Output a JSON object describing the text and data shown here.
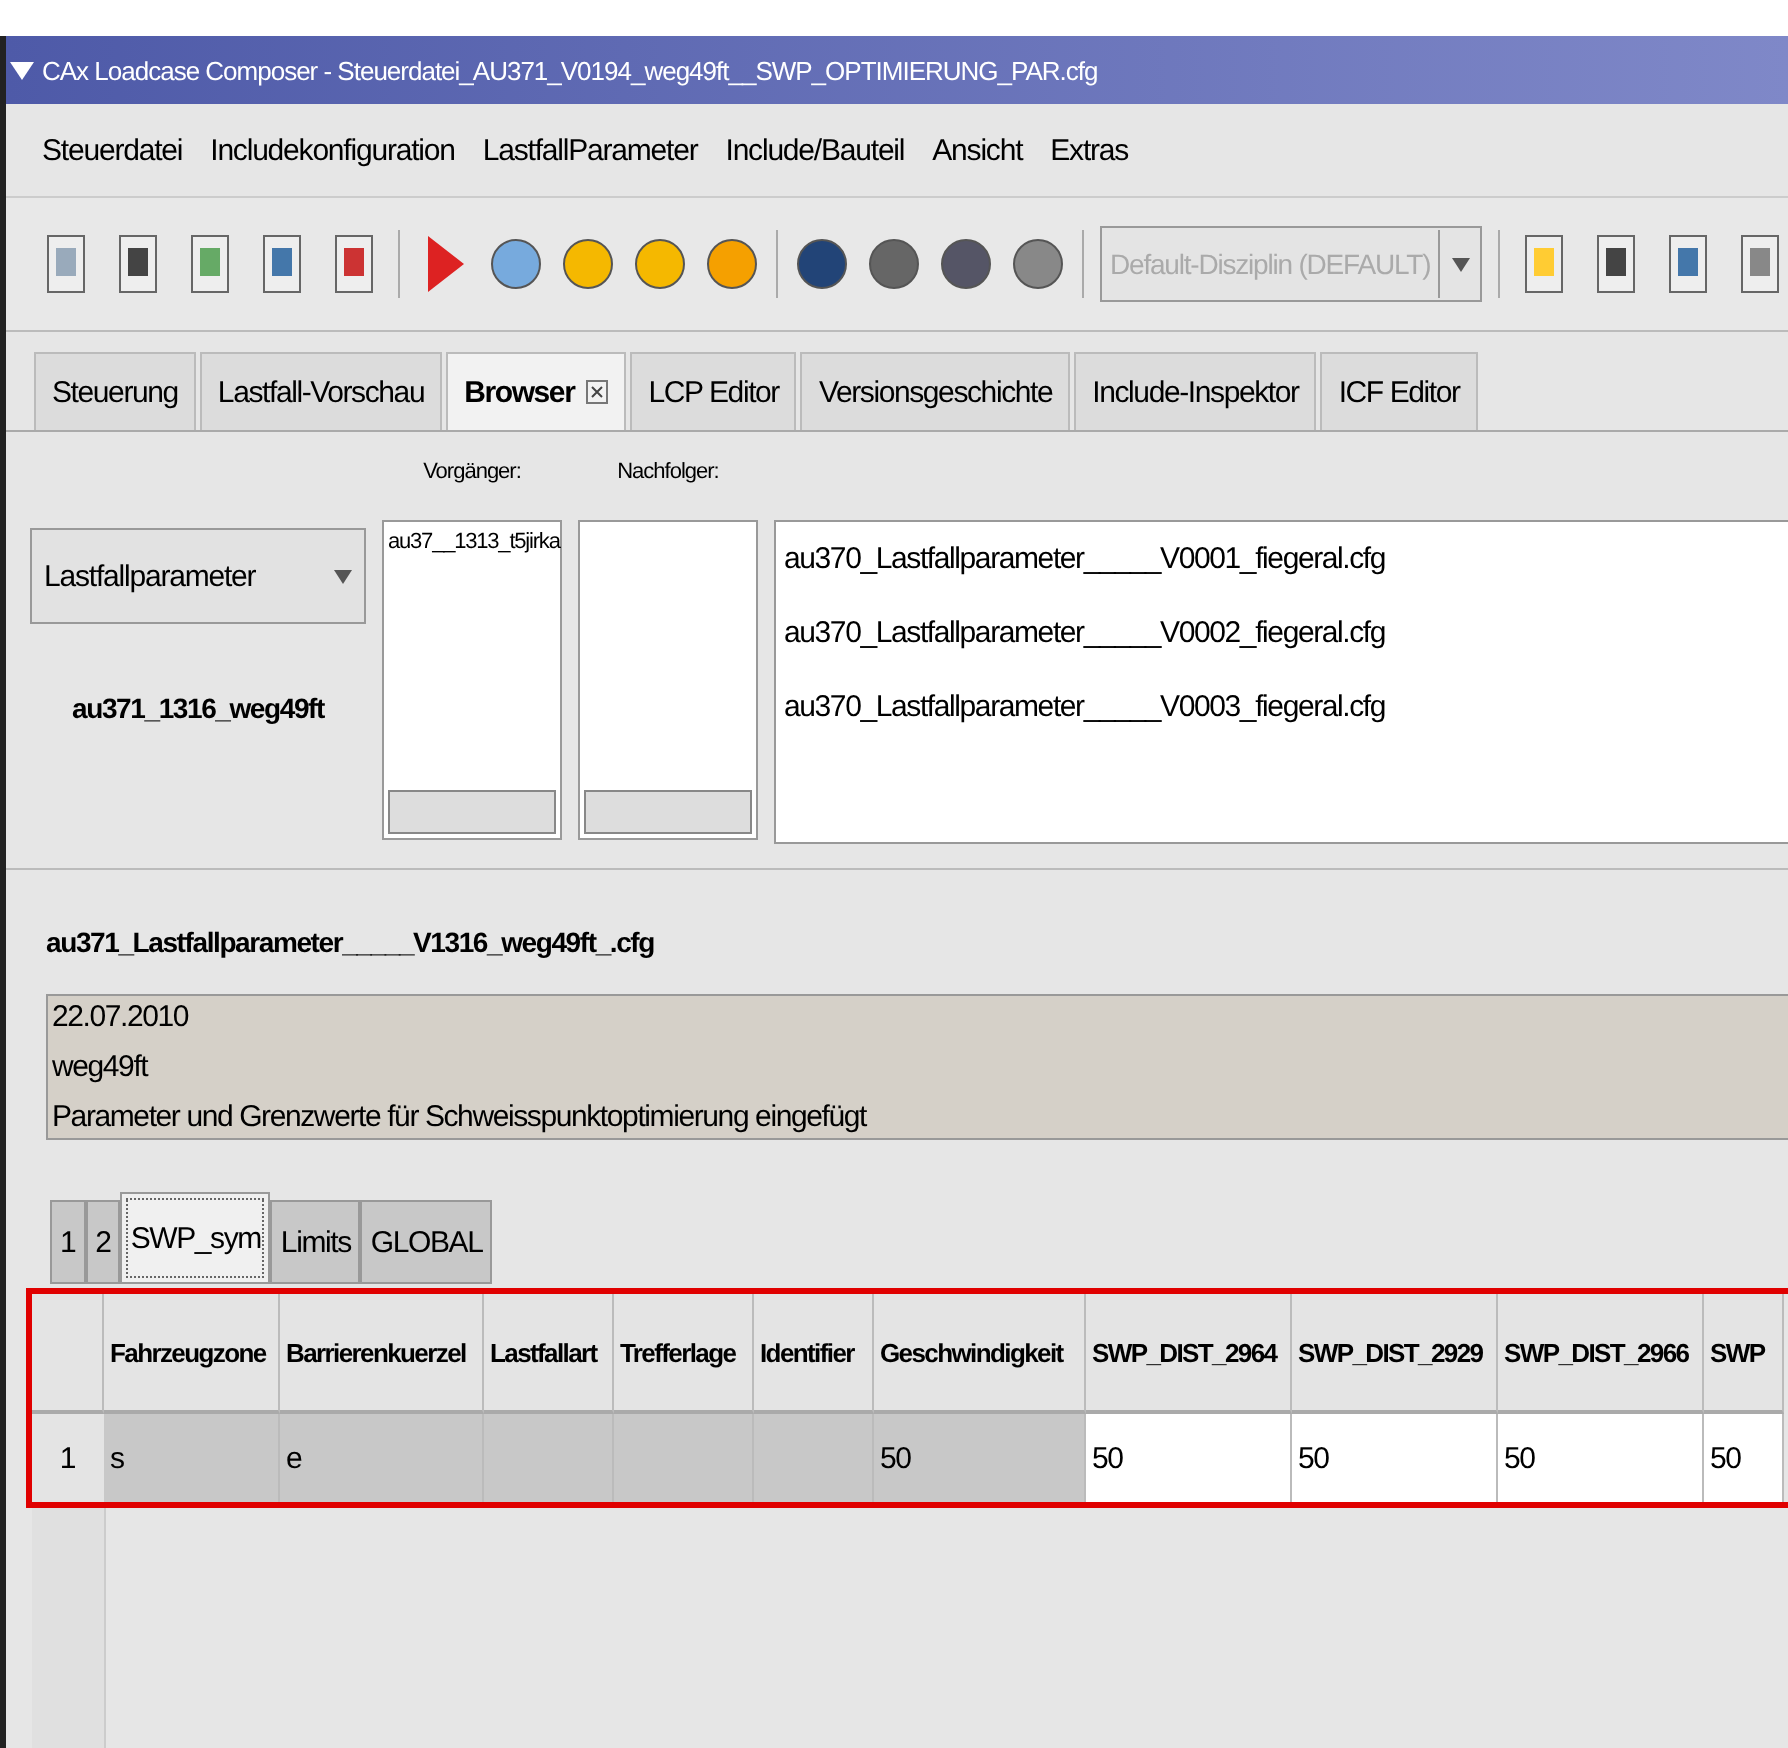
{
  "window": {
    "title": "CAx Loadcase Composer - Steuerdatei_AU371_V0194_weg49ft__SWP_OPTIMIERUNG_PAR.cfg"
  },
  "menu": [
    "Steuerdatei",
    "Includekonfiguration",
    "LastfallParameter",
    "Include/Bauteil",
    "Ansicht",
    "Extras"
  ],
  "toolbar": {
    "discipline": {
      "value": "Default-Disziplin (DEFAULT)",
      "disabled": true
    }
  },
  "tabs": [
    {
      "label": "Steuerung",
      "selected": false
    },
    {
      "label": "Lastfall-Vorschau",
      "selected": false
    },
    {
      "label": "Browser",
      "selected": true,
      "closable": true
    },
    {
      "label": "LCP Editor",
      "selected": false
    },
    {
      "label": "Versionsgeschichte",
      "selected": false
    },
    {
      "label": "Include-Inspektor",
      "selected": false
    },
    {
      "label": "ICF Editor",
      "selected": false
    }
  ],
  "browser": {
    "type_select": "Lastfallparameter",
    "current": "au371_1316_weg49ft",
    "predecessor": {
      "label": "Vorgänger:",
      "items": [
        "au37__1313_t5jirka"
      ]
    },
    "successor": {
      "label": "Nachfolger:"
    },
    "files": [
      "au370_Lastfallparameter_____V0001_fiegeral.cfg",
      "au370_Lastfallparameter_____V0002_fiegeral.cfg",
      "au370_Lastfallparameter_____V0003_fiegeral.cfg"
    ]
  },
  "detail": {
    "filename": "au371_Lastfallparameter_____V1316_weg49ft_.cfg",
    "comment": [
      "22.07.2010",
      "weg49ft",
      "Parameter und Grenzwerte für Schweisspunktoptimierung eingefügt"
    ]
  },
  "subtabs": [
    {
      "label": "1",
      "selected": false
    },
    {
      "label": "2",
      "selected": false
    },
    {
      "label": "SWP_sym",
      "selected": true
    },
    {
      "label": "Limits",
      "selected": false
    },
    {
      "label": "GLOBAL",
      "selected": false
    }
  ],
  "table": {
    "highlighted": true,
    "columns": [
      {
        "label": "Fahrzeugzone",
        "editable": false
      },
      {
        "label": "Barrierenkuerzel",
        "editable": false
      },
      {
        "label": "Lastfallart",
        "editable": false
      },
      {
        "label": "Trefferlage",
        "editable": false
      },
      {
        "label": "Identifier",
        "editable": false
      },
      {
        "label": "Geschwindigkeit",
        "editable": false
      },
      {
        "label": "SWP_DIST_2964",
        "editable": true
      },
      {
        "label": "SWP_DIST_2929",
        "editable": true
      },
      {
        "label": "SWP_DIST_2966",
        "editable": true
      },
      {
        "label": "SWP",
        "editable": true
      }
    ],
    "rows": [
      {
        "number": "1",
        "cells": [
          "s",
          "e",
          "",
          "",
          "",
          "50",
          "50",
          "50",
          "50",
          "50"
        ]
      }
    ]
  }
}
